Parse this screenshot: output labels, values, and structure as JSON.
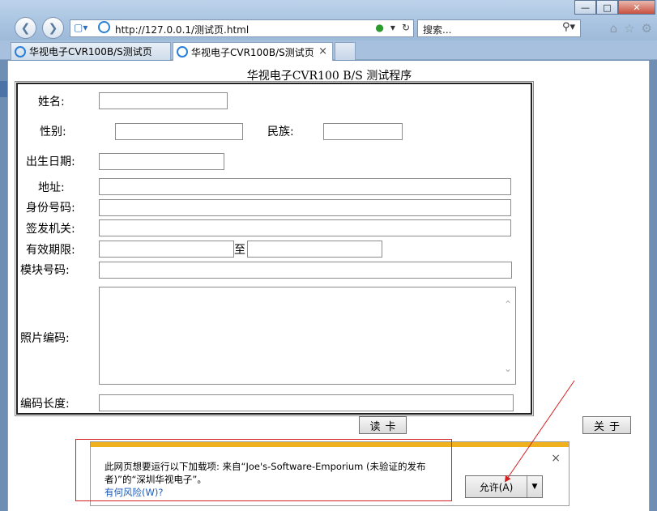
{
  "browser": {
    "address": "http://127.0.0.1/测试页.html",
    "search_placeholder": "搜索...",
    "tabs": [
      {
        "label": "华视电子CVR100B/S测试页"
      },
      {
        "label": "华视电子CVR100B/S测试页"
      }
    ],
    "tab_close": "×"
  },
  "page": {
    "title": "华视电子CVR100 B/S 测试程序",
    "labels": {
      "name": "姓名:",
      "sex": "性别:",
      "nation": "民族:",
      "birth": "出生日期:",
      "address": "地址:",
      "id_number": "身份号码:",
      "issuer": "签发机关:",
      "validity": "有效期限:",
      "validity_to": "至",
      "module_number": "模块号码:",
      "photo_code": "照片编码:",
      "code_length": "编码长度:"
    },
    "buttons": {
      "read_card": "读卡",
      "about": "关于"
    }
  },
  "notification": {
    "message": "此网页想要运行以下加载项: 来自“Joe's-Software-Emporium (未验证的发布者)”的“深圳华视电子”。",
    "link": "有何风险(W)?",
    "allow": "允许(A)",
    "close": "×"
  },
  "colors": {
    "notification_stripe": "#f0b11e",
    "annotation": "#d42020",
    "link": "#1a5bb8"
  }
}
